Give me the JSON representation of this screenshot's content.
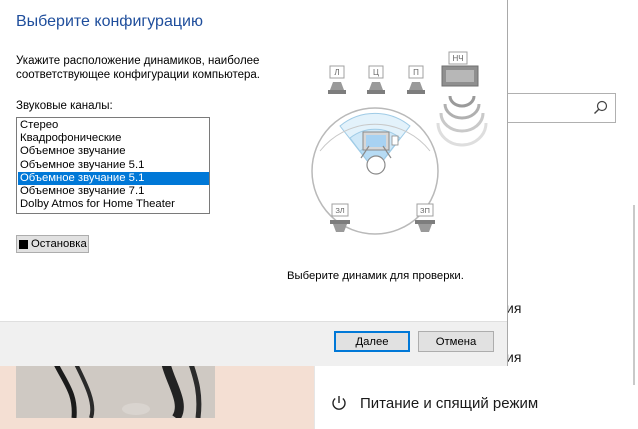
{
  "dialog": {
    "title": "Выберите конфигурацию",
    "description": "Укажите расположение динамиков, наиболее соответствующее конфигурации компьютера.",
    "channels_label": "Звуковые каналы:",
    "options": [
      "Стерео",
      "Квадрофонические",
      "Объемное звучание",
      "Объемное звучание 5.1",
      "Объемное звучание 5.1",
      "Объемное звучание 7.1",
      "Dolby Atmos for Home Theater"
    ],
    "selected_index": 4,
    "stop_label": "Остановка",
    "hint": "Выберите динамик для проверки.",
    "next_label": "Далее",
    "cancel_label": "Отмена",
    "speakers": {
      "front_left": "Л",
      "center": "Ц",
      "front_right": "П",
      "subwoofer": "НЧ",
      "rear_left": "ЗЛ",
      "rear_right": "ЗП"
    },
    "accent_color": "#0078d7",
    "title_color": "#1f4e9c"
  },
  "settings": {
    "frag_1": "ия",
    "frag_2": "ия",
    "power_label": "Питание и спящий режим"
  }
}
